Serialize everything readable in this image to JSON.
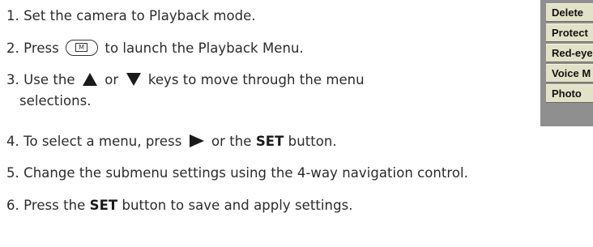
{
  "steps": {
    "s1": "1. Set the camera to Playback mode.",
    "s2_pre": "2. Press",
    "s2_key": "M",
    "s2_post": "to launch the Playback Menu.",
    "s3_pre": "3. Use the",
    "s3_mid": "or",
    "s3_post": "keys to move through the menu",
    "s3_cont": "selections.",
    "s4_pre": "4. To select a menu, press",
    "s4_mid": "or the",
    "s4_bold": "SET",
    "s4_post": "button.",
    "s5": "5. Change the submenu settings using the 4-way navigation control.",
    "s6_pre": "6. Press the",
    "s6_bold": "SET",
    "s6_post": "button to save and apply settings."
  },
  "playback_menu": {
    "items": [
      "Delete",
      "Protect",
      "Red-eye",
      "Voice M",
      "Photo"
    ]
  },
  "icons": {
    "menu_key": "m-button-icon",
    "up": "triangle-up-icon",
    "down": "triangle-down-icon",
    "right": "triangle-right-icon"
  },
  "colors": {
    "text": "#2b2b2b",
    "menu_panel": "#8f8f8f",
    "menu_item": "#e2e2c8"
  }
}
